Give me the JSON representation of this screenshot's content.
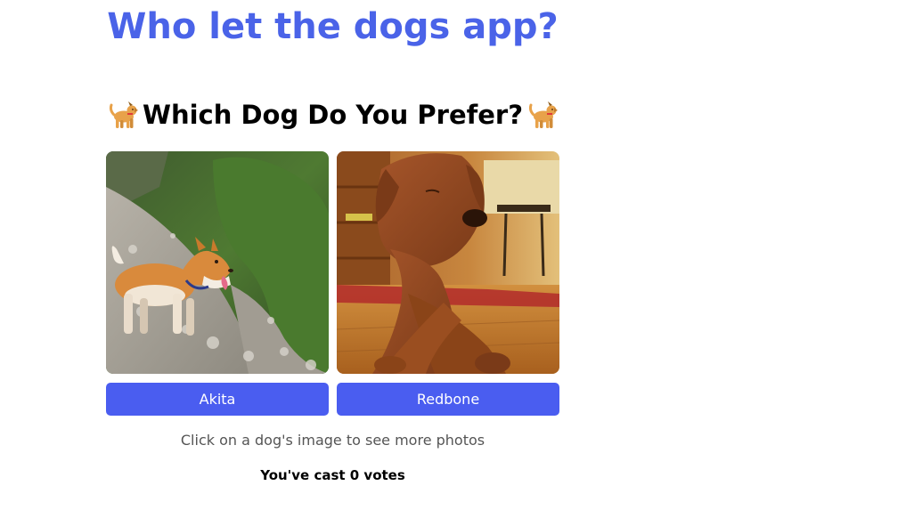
{
  "app": {
    "title": "Who let the dogs app?"
  },
  "question": {
    "text": "Which Dog Do You Prefer?",
    "left_icon": "dog-icon",
    "right_icon": "dog-icon"
  },
  "choices": [
    {
      "breed": "Akita",
      "photo": "akita-photo"
    },
    {
      "breed": "Redbone",
      "photo": "redbone-photo"
    }
  ],
  "hint": "Click on a dog's image to see more photos",
  "votes": {
    "text": "You've cast 0 votes"
  },
  "colors": {
    "title": "#4a63e8",
    "button": "#4a5df0",
    "button_text": "#ffffff",
    "hint": "#555555"
  }
}
